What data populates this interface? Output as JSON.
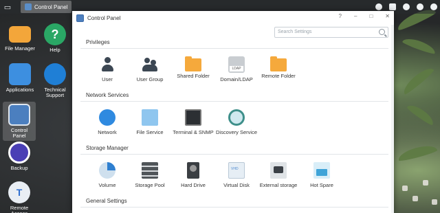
{
  "taskbar": {
    "active_app": "Control Panel"
  },
  "desktop": {
    "icons": [
      {
        "label": "File Manager"
      },
      {
        "label": "Help"
      },
      {
        "label": "Applications"
      },
      {
        "label": "Technical Support"
      },
      {
        "label": "Control Panel"
      },
      {
        "label": "Backup"
      },
      {
        "label": "Remote Access"
      }
    ]
  },
  "window": {
    "title": "Control Panel",
    "controls": [
      "?",
      "–",
      "□",
      "✕"
    ],
    "search_placeholder": "Search Settings",
    "sections": [
      {
        "title": "Privileges",
        "items": [
          "User",
          "User Group",
          "Shared Folder",
          "Domain/LDAP",
          "Remote Folder"
        ]
      },
      {
        "title": "Network Services",
        "items": [
          "Network",
          "File Service",
          "Terminal & SNMP",
          "Discovery Service"
        ]
      },
      {
        "title": "Storage Manager",
        "items": [
          "Volume",
          "Storage Pool",
          "Hard Drive",
          "Virtual Disk",
          "External storage",
          "Hot Spare"
        ]
      },
      {
        "title": "General Settings",
        "items": []
      }
    ],
    "ldap_badge": "LDAP",
    "vhd_badge": "VHD"
  }
}
